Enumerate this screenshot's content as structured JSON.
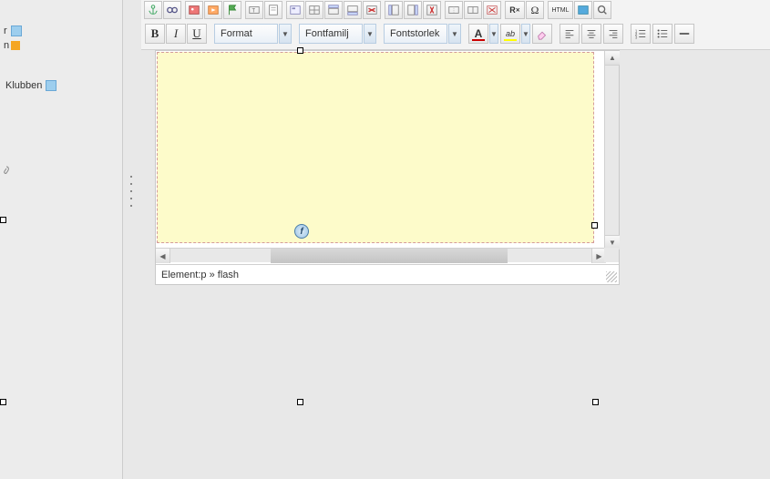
{
  "sidebar": {
    "items": [
      {
        "label": "r"
      },
      {
        "label": "n"
      },
      {
        "label": "Klubben"
      }
    ]
  },
  "toolbar": {
    "bold": "B",
    "italic": "I",
    "underline": "U",
    "format": {
      "label": "Format"
    },
    "fontfamily": {
      "label": "Fontfamilj"
    },
    "fontsize": {
      "label": "Fontstorlek"
    },
    "textcolor_letter": "A",
    "highlight_glyph": "ab",
    "html_label": "HTML"
  },
  "status": {
    "prefix": "Element: ",
    "path": "p » flash"
  },
  "canvas": {
    "flash_glyph": "f"
  }
}
